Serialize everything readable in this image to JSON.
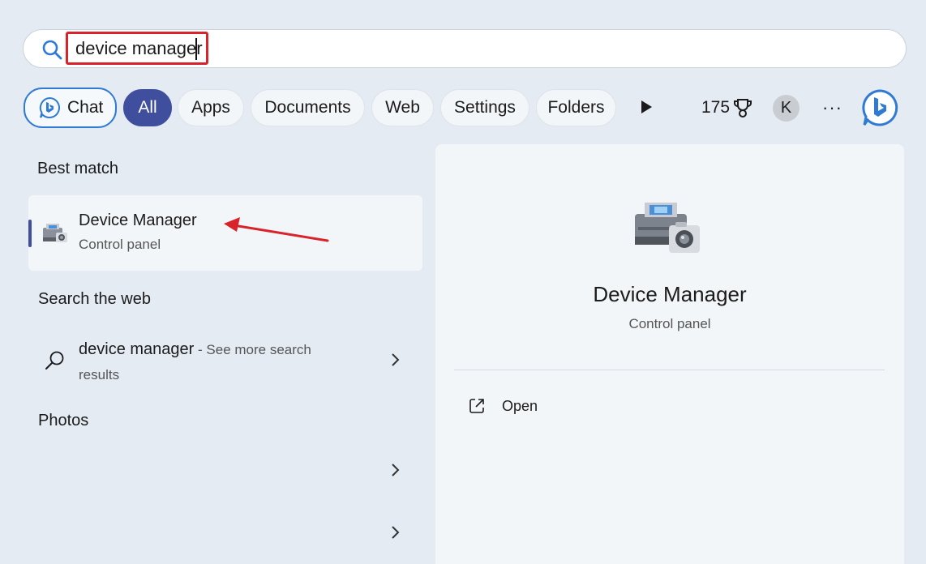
{
  "search": {
    "value": "device manager",
    "placeholder": ""
  },
  "filters": {
    "chat_label": "Chat",
    "items": [
      "All",
      "Apps",
      "Documents",
      "Web",
      "Settings",
      "Folders"
    ],
    "active": "All",
    "points": "175",
    "avatar_initial": "K",
    "more": "···"
  },
  "best_match": {
    "heading": "Best match",
    "title": "Device Manager",
    "subtitle": "Control panel"
  },
  "web": {
    "heading": "Search the web",
    "query": "device manager",
    "suffix": " - See more search results"
  },
  "photos": {
    "heading": "Photos"
  },
  "preview": {
    "title": "Device Manager",
    "subtitle": "Control panel",
    "action_open": "Open"
  },
  "colors": {
    "accent": "#3f4f9d",
    "highlight": "#d8232a",
    "background": "#e4ebf3"
  }
}
